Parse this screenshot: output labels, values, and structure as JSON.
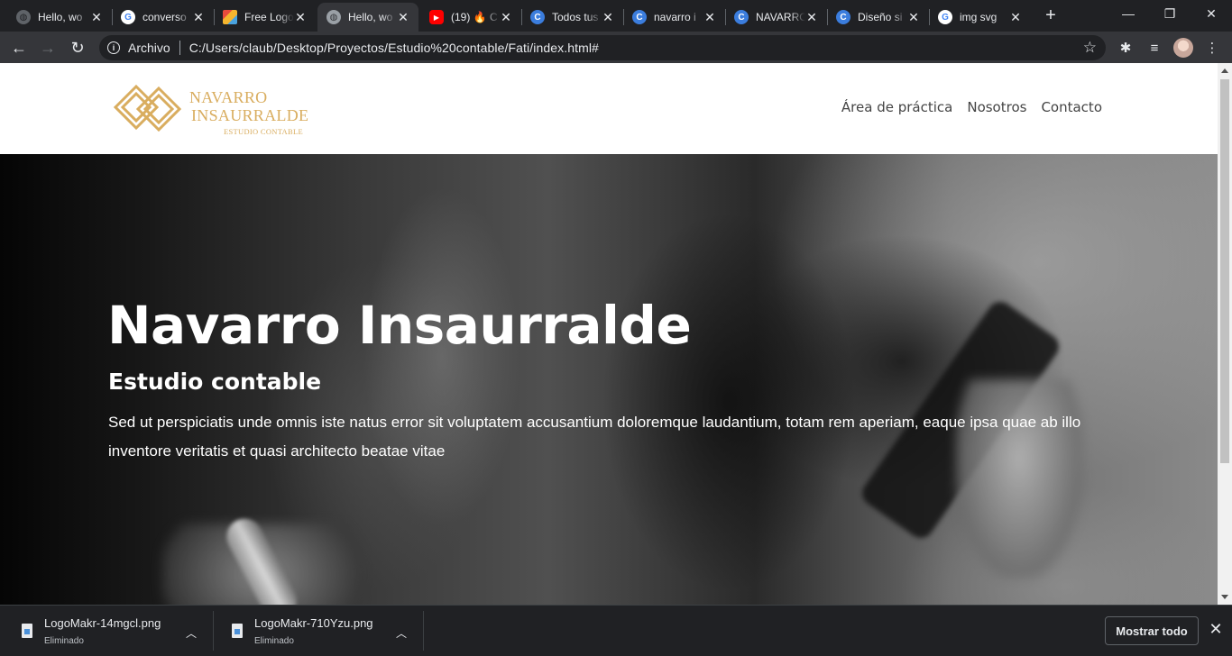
{
  "browser": {
    "tabs": [
      {
        "title": "Hello, wo",
        "favicon": "globe-icon",
        "active": false
      },
      {
        "title": "converso",
        "favicon": "google-icon",
        "active": false
      },
      {
        "title": "Free Logo",
        "favicon": "logomakr-icon",
        "active": false
      },
      {
        "title": "Hello, wo",
        "favicon": "globe-icon",
        "active": true
      },
      {
        "title": "(19) 🔥 C",
        "favicon": "youtube-icon",
        "active": false
      },
      {
        "title": "Todos tus",
        "favicon": "canva-icon",
        "active": false
      },
      {
        "title": "navarro i",
        "favicon": "canva-icon",
        "active": false
      },
      {
        "title": "NAVARRO",
        "favicon": "canva-icon",
        "active": false
      },
      {
        "title": "Diseño si",
        "favicon": "canva-icon",
        "active": false
      },
      {
        "title": "img svg",
        "favicon": "google-icon",
        "active": false
      }
    ],
    "new_tab_label": "+",
    "address": {
      "scheme_label": "Archivo",
      "url": "C:/Users/claub/Desktop/Proyectos/Estudio%20contable/Fati/index.html#"
    }
  },
  "site": {
    "logo": {
      "line1": "NAVARRO",
      "line2": "INSAURRALDE",
      "line3": "ESTUDIO CONTABLE",
      "color": "#d9ad5f"
    },
    "nav": [
      "Área de práctica",
      "Nosotros",
      "Contacto"
    ],
    "hero": {
      "title": "Navarro Insaurralde",
      "subtitle": "Estudio contable",
      "text": "Sed ut perspiciatis unde omnis iste natus error sit voluptatem accusantium doloremque laudantium, totam rem aperiam, eaque ipsa quae ab illo inventore veritatis et quasi architecto beatae vitae"
    }
  },
  "downloads": {
    "items": [
      {
        "name": "LogoMakr-14mgcl.png",
        "status": "Eliminado"
      },
      {
        "name": "LogoMakr-710Yzu.png",
        "status": "Eliminado"
      }
    ],
    "show_all_label": "Mostrar todo"
  }
}
